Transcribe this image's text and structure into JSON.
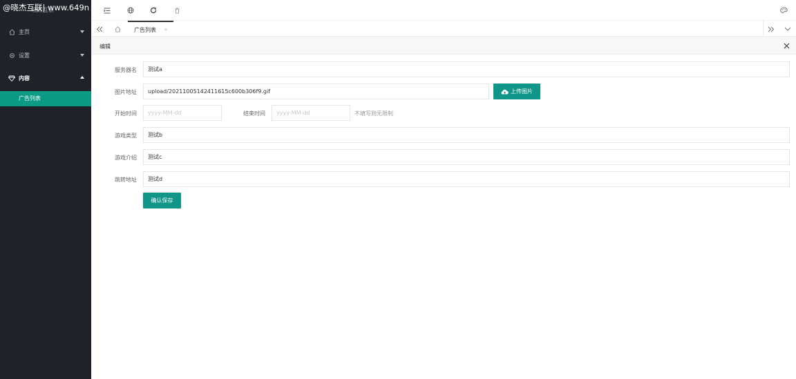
{
  "sidebar": {
    "watermark": "@晓杰互联| www.649n",
    "logo_text": "晓杰互联",
    "items": [
      {
        "label": "主页",
        "icon": "home-icon",
        "expanded": false
      },
      {
        "label": "设置",
        "icon": "settings-icon",
        "expanded": false
      },
      {
        "label": "内容",
        "icon": "diamond-icon",
        "expanded": true
      }
    ],
    "sub_items": [
      {
        "label": "广告列表",
        "active": true
      }
    ]
  },
  "header": {
    "icons": [
      "menu-fold-icon",
      "globe-icon",
      "refresh-icon",
      "clear-icon",
      "theme-icon"
    ]
  },
  "tabs": {
    "items": [
      {
        "label": "广告列表",
        "close": "×"
      }
    ]
  },
  "panel": {
    "title": "编辑",
    "close": "×"
  },
  "form": {
    "server_name": {
      "label": "服务器名",
      "value": "测试a"
    },
    "image_url": {
      "label": "图片地址",
      "value": "upload/20211005142411615c600b306f9.gif"
    },
    "upload_button": "上传图片",
    "start_time": {
      "label": "开始时间",
      "placeholder": "yyyy-MM-dd"
    },
    "end_time": {
      "label": "结束时间",
      "placeholder": "yyyy-MM-dd"
    },
    "time_hint": "不填写则无限制",
    "game_type": {
      "label": "游戏类型",
      "value": "测试b"
    },
    "game_intro": {
      "label": "游戏介绍",
      "value": "测试c"
    },
    "jump_url": {
      "label": "跳转地址",
      "value": "测试d"
    },
    "submit_button": "确认保存"
  },
  "colors": {
    "sidebar_bg": "#20222a",
    "accent": "#0f9688",
    "active_item": "#0b9a84"
  }
}
